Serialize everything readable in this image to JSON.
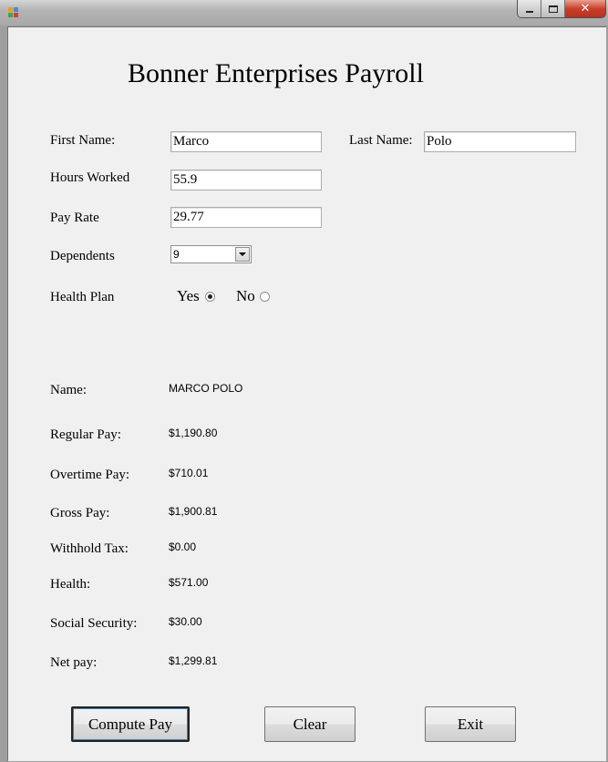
{
  "form": {
    "title": "Bonner Enterprises Payroll",
    "first_name_label": "First Name:",
    "first_name_value": "Marco",
    "last_name_label": "Last Name:",
    "last_name_value": "Polo",
    "hours_label": "Hours Worked",
    "hours_value": "55.9",
    "pay_rate_label": "Pay Rate",
    "pay_rate_value": "29.77",
    "dependents_label": "Dependents",
    "dependents_value": "9",
    "health_plan_label": "Health Plan",
    "health_yes_label": "Yes",
    "health_no_label": "No",
    "health_selected": "Yes"
  },
  "results": [
    {
      "label": "Name:",
      "value": "MARCO POLO"
    },
    {
      "label": "Regular Pay:",
      "value": "$1,190.80"
    },
    {
      "label": "Overtime Pay:",
      "value": "$710.01"
    },
    {
      "label": "Gross Pay:",
      "value": "$1,900.81"
    },
    {
      "label": "Withhold Tax:",
      "value": "$0.00"
    },
    {
      "label": "Health:",
      "value": "$571.00"
    },
    {
      "label": "Social Security:",
      "value": "$30.00"
    },
    {
      "label": "Net pay:",
      "value": "$1,299.81"
    }
  ],
  "buttons": {
    "compute": "Compute Pay",
    "clear": "Clear",
    "exit": "Exit"
  },
  "window_controls": {
    "close_glyph": "✕"
  }
}
